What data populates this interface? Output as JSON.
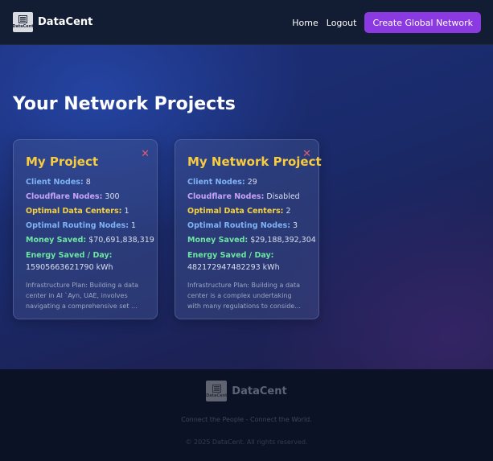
{
  "nav": {
    "brand_name": "DataCent",
    "logo_text": "DataCent",
    "links": [
      "Home",
      "Logout"
    ],
    "cta_label": "Create Global Network"
  },
  "page": {
    "title": "Your Network Projects"
  },
  "projects": [
    {
      "name": "My Project",
      "stats": [
        {
          "label": "Client Nodes:",
          "value": "8",
          "color": "#7eb3f6"
        },
        {
          "label": "Cloudflare Nodes:",
          "value": "300",
          "color": "#c7a2f7"
        },
        {
          "label": "Optimal Data Centers:",
          "value": "1",
          "color": "#f5d23e"
        },
        {
          "label": "Optimal Routing Nodes:",
          "value": "1",
          "color": "#7eb3f6"
        },
        {
          "label": "Money Saved:",
          "value": "$70,691,838,319",
          "color": "#6ee6a3"
        },
        {
          "label": "Energy Saved / Day:",
          "value": "15905663621790 kWh",
          "color": "#6ee6a3"
        }
      ],
      "plan": "Infrastructure Plan: Building a data center in Al `Ayn, UAE, involves navigating a comprehensive set ..."
    },
    {
      "name": "My Network Project",
      "stats": [
        {
          "label": "Client Nodes:",
          "value": "29",
          "color": "#7eb3f6"
        },
        {
          "label": "Cloudflare Nodes:",
          "value": "Disabled",
          "color": "#c7a2f7"
        },
        {
          "label": "Optimal Data Centers:",
          "value": "2",
          "color": "#f5d23e"
        },
        {
          "label": "Optimal Routing Nodes:",
          "value": "3",
          "color": "#7eb3f6"
        },
        {
          "label": "Money Saved:",
          "value": "$29,188,392,304",
          "color": "#6ee6a3"
        },
        {
          "label": "Energy Saved / Day:",
          "value": "482172947482293 kWh",
          "color": "#6ee6a3"
        }
      ],
      "plan": "Infrastructure Plan: Building a data center is a complex undertaking with many regulations to conside..."
    }
  ],
  "footer": {
    "brand_name": "DataCent",
    "tagline": "Connect the People - Connect the World.",
    "copyright": "© 2025 DataCent. All rights reserved."
  },
  "colors": {
    "accent": "#8b3ae2",
    "card_title": "#f7cc3f",
    "close": "#e05a74"
  },
  "icons": [
    "datacent-logo-icon",
    "close-icon"
  ]
}
